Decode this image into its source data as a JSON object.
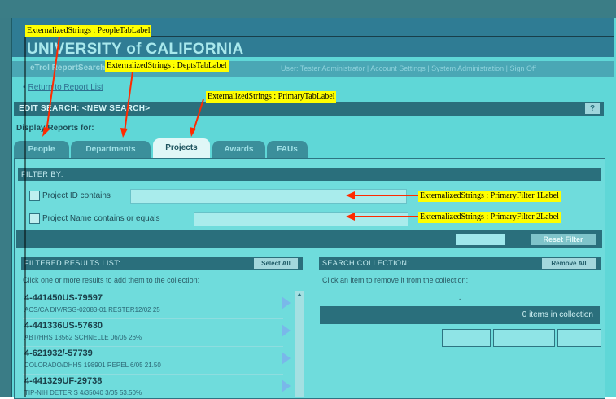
{
  "banner": {
    "org_name": "UNIVERSITY of CALIFORNIA"
  },
  "nav": {
    "left_text": "eTrol ReportSearch",
    "right_text": "User: Tester Administrator | Account Settings | System Administration | Sign Off"
  },
  "return_link": "Return to Report List",
  "edit_bar": {
    "title": "EDIT SEARCH: <NEW SEARCH>",
    "help_label": "?"
  },
  "display_label": "Display Reports for:",
  "tabs": [
    {
      "label": "People"
    },
    {
      "label": "Departments"
    },
    {
      "label": "Projects",
      "active": true
    },
    {
      "label": "Awards"
    },
    {
      "label": "FAUs"
    }
  ],
  "filter": {
    "header": "FILTER BY:",
    "rows": [
      {
        "label": "Project ID contains",
        "value": ""
      },
      {
        "label": "Project Name contains or equals",
        "value": ""
      }
    ],
    "reset_label": "Reset Filter"
  },
  "results": {
    "header": "FILTERED RESULTS LIST:",
    "select_all_label": "Select All",
    "instructions": "Click one or more results to add them to the collection:",
    "items": [
      {
        "id": "4-441450US-79597",
        "desc": "ACS/CA DIV/RSG-02083-01 RESTER12/02 25"
      },
      {
        "id": "4-441336US-57630",
        "desc": "ABT/HHS 13562 SCHNELLE 06/05 26%"
      },
      {
        "id": "4-621932/-57739",
        "desc": "COLORADO/DHHS 198901 REPEL 6/05 21.50"
      },
      {
        "id": "4-441329UF-29738",
        "desc": "TIP-NIH DETER S 4/35040 3/05 53.50%"
      }
    ]
  },
  "collection": {
    "header": "SEARCH COLLECTION:",
    "remove_all_label": "Remove All",
    "instructions": "Click an item to remove it from the collection:",
    "placeholder_dash": "-",
    "count_text": "0 items in collection"
  },
  "annotations": {
    "people": "ExternalizedStrings  : PeopleTabLabel",
    "depts": "ExternalizedStrings  : DeptsTabLabel",
    "primary": "ExternalizedStrings  : PrimaryTabLabel",
    "filter1": "ExternalizedStrings  : PrimaryFilter 1Label",
    "filter2": "ExternalizedStrings  : PrimaryFilter 2Label"
  },
  "colors": {
    "annotation_bg": "#ffff00",
    "arrow": "#ff2a00",
    "panel": "#5fd7d7",
    "dark_bar": "#2a6f7c"
  }
}
